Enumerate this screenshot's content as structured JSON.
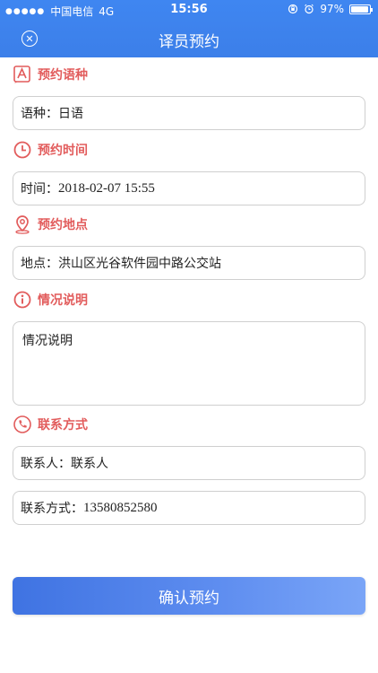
{
  "status_bar": {
    "carrier": "中国电信",
    "network": "4G",
    "time": "15:56",
    "battery": "97%",
    "battery_level": 0.97
  },
  "nav": {
    "title": "译员预约",
    "close_icon": "close-circle-icon"
  },
  "sections": {
    "language": {
      "label": "预约语种",
      "icon": "language-a-icon",
      "field": "语种：日语"
    },
    "time": {
      "label": "预约时间",
      "icon": "clock-icon",
      "field_label": "时间：",
      "field_value": "2018-02-07 15:55"
    },
    "location": {
      "label": "预约地点",
      "icon": "location-pin-icon",
      "field": "地点：洪山区光谷软件园中路公交站"
    },
    "description": {
      "label": "情况说明",
      "icon": "info-icon",
      "field": "情况说明"
    },
    "contact": {
      "label": "联系方式",
      "icon": "phone-icon",
      "person_field": "联系人：联系人",
      "phone_label": "联系方式：",
      "phone_value": "13580852580"
    }
  },
  "confirm_button": {
    "label": "确认预约"
  },
  "colors": {
    "header": "#3f86f1",
    "section_label": "#e25c5c",
    "field_border": "#cfcfcf",
    "button_start": "#3f73e2",
    "button_end": "#7aa5f7"
  }
}
